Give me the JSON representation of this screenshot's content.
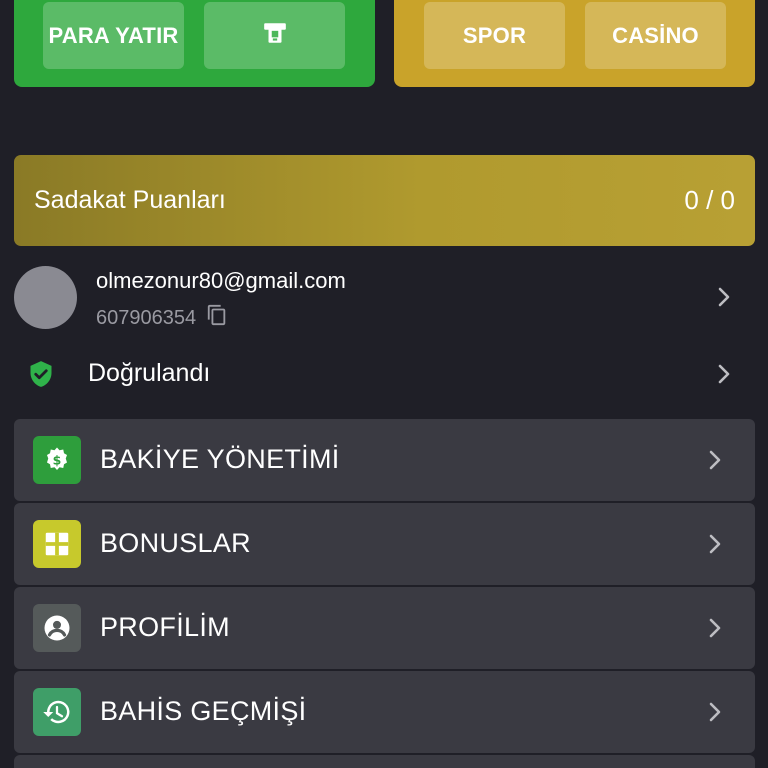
{
  "top": {
    "deposit_label": "PARA YATIR",
    "atm_icon": "atm-icon",
    "sport_label": "SPOR",
    "casino_label": "CASİNO"
  },
  "loyalty": {
    "label": "Sadakat Puanları",
    "value": "0 / 0"
  },
  "user": {
    "email": "olmezonur80@gmail.com",
    "id": "607906354",
    "copy_icon": "copy-icon",
    "verified_label": "Doğrulandı",
    "verified_icon": "verified-shield-icon"
  },
  "menu": [
    {
      "label": "BAKİYE YÖNETİMİ",
      "icon": "money-gear-icon",
      "color": "#2e9e3c"
    },
    {
      "label": "BONUSLAR",
      "icon": "gift-icon",
      "color": "#c7c92c"
    },
    {
      "label": "PROFİLİM",
      "icon": "account-icon",
      "color": "#555a5a"
    },
    {
      "label": "BAHİS GEÇMİŞİ",
      "icon": "history-icon",
      "color": "#3f9e68"
    }
  ],
  "colors": {
    "background": "#1f1f27",
    "green": "#2ea83d",
    "gold": "#c9a32a",
    "card": "#3a3a42"
  }
}
